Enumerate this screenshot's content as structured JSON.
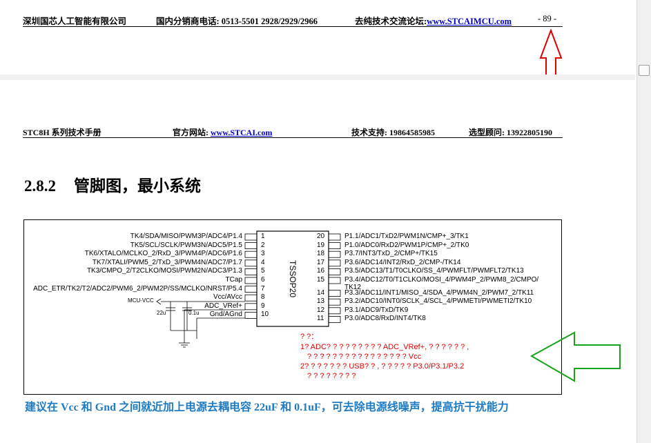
{
  "top_header": {
    "company": "深圳国芯人工智能有限公司",
    "phone": "国内分销商电话: 0513-5501 2928/2929/2966",
    "forum_label": "去纯技术交流论坛:",
    "forum_link": "www.STCAIMCU.com",
    "page_number": "- 89 -"
  },
  "header": {
    "manual": "STC8H 系列技术手册",
    "website_label": "官方网站: ",
    "website_link": "www.STCAI.com",
    "support": "技术支持: 19864585985",
    "consult": "选型顾问: 13922805190"
  },
  "section": {
    "number": "2.8.2",
    "title": "管脚图，最小系统"
  },
  "chip": {
    "name": "TSSOP20",
    "left_pins": [
      {
        "no": "1",
        "label": "TK4/SDA/MISO/PWM3P/ADC4/P1.4"
      },
      {
        "no": "2",
        "label": "TK5/SCL/SCLK/PWM3N/ADC5/P1.5"
      },
      {
        "no": "3",
        "label": "TK6/XTALO/MCLKO_2/RxD_3/PWM4P/ADC6/P1.6"
      },
      {
        "no": "4",
        "label": "TK7/XTALI/PWM5_2/TxD_3/PWM4N/ADC7/P1.7"
      },
      {
        "no": "5",
        "label": "TK3/CMPO_2/T2CLKO/MOSI/PWM2N/ADC3/P1.3"
      },
      {
        "no": "6",
        "label": "TCap"
      },
      {
        "no": "7",
        "label": "ADC_ETR/TK2/T2/ADC2/PWM6_2/PWM2P/SS/MCLKO/NRST/P5.4"
      },
      {
        "no": "8",
        "label": "Vcc/AVcc"
      },
      {
        "no": "9",
        "label": "ADC_VRef+"
      },
      {
        "no": "10",
        "label": "Gnd/AGnd"
      }
    ],
    "right_pins": [
      {
        "no": "20",
        "label": "P1.1/ADC1/TxD2/PWM1N/CMP+_3/TK1"
      },
      {
        "no": "19",
        "label": "P1.0/ADC0/RxD2/PWM1P/CMP+_2/TK0"
      },
      {
        "no": "18",
        "label": "P3.7/INT3/TxD_2/CMP+/TK15"
      },
      {
        "no": "17",
        "label": "P3.6/ADC14/INT2/RxD_2/CMP-/TK14"
      },
      {
        "no": "16",
        "label": "P3.5/ADC13/T1/T0CLKO/SS_4/PWMFLT/PWMFLT2/TK13"
      },
      {
        "no": "15",
        "label": "P3.4/ADC12/T0/T1CLKO/MOSI_4/PWM4P_2/PWM8_2/CMPO/"
      },
      {
        "no": "14",
        "label": "P3.3/ADC11/INT1/MISO_4/SDA_4/PWM4N_2/PWM7_2/TK11"
      },
      {
        "no": "13",
        "label": "P3.2/ADC10/INT0/SCLK_4/SCL_4/PWMETI/PWMETI2/TK10"
      },
      {
        "no": "12",
        "label": "P3.1/ADC9/TxD/TK9"
      },
      {
        "no": "11",
        "label": "P3.0/ADC8/RxD/INT4/TK8"
      }
    ],
    "pin15_cont": "TK12",
    "mcu_vcc": "MCU-VCC",
    "cap1": "22u",
    "cap2": "0.1u"
  },
  "notes": {
    "line1": "? ?：",
    "line2": "1? ADC? ? ? ? ? ? ? ? ? ADC_VRef+, ? ? ? ? ? ? ,",
    "line3": "? ? ? ? ? ? ? ? ? ? ? ? ? ? ? ? Vcc",
    "line4": "2? ? ? ? ? ? ? USB? ? , ? ? ? ? ? P3.0/P3.1/P3.2",
    "line5": "? ? ? ? ? ? ? ?"
  },
  "tip": "建议在 Vcc 和 Gnd 之间就近加上电源去耦电容 22uF 和 0.1uF，可去除电源线噪声，提高抗干扰能力",
  "colors": {
    "note_red": "#e00000",
    "arrow_red": "#dd0000",
    "arrow_green": "#19a319",
    "tip_blue": "#1e7bc4",
    "link_blue": "#0000cc"
  }
}
